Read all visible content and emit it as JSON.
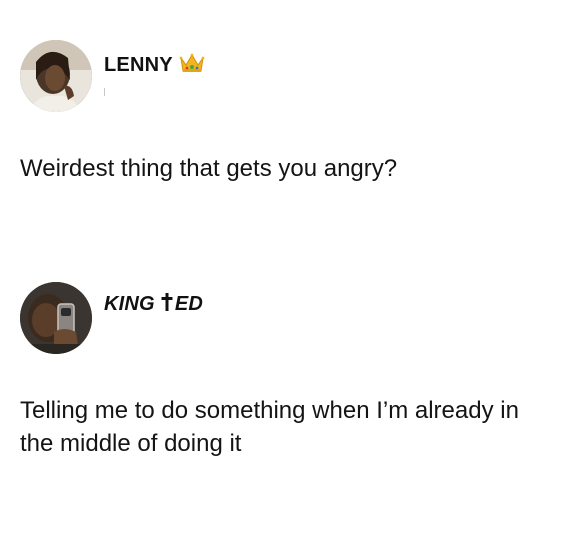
{
  "posts": [
    {
      "author": "LENNY",
      "badge_icon": "crown-emoji-icon",
      "text": "Weirdest thing that gets you angry?"
    },
    {
      "author": "KING",
      "author_suffix": "ED",
      "badge_icon": "cross-icon",
      "text": "Telling me to do something when I’m already in the middle of doing it"
    }
  ]
}
